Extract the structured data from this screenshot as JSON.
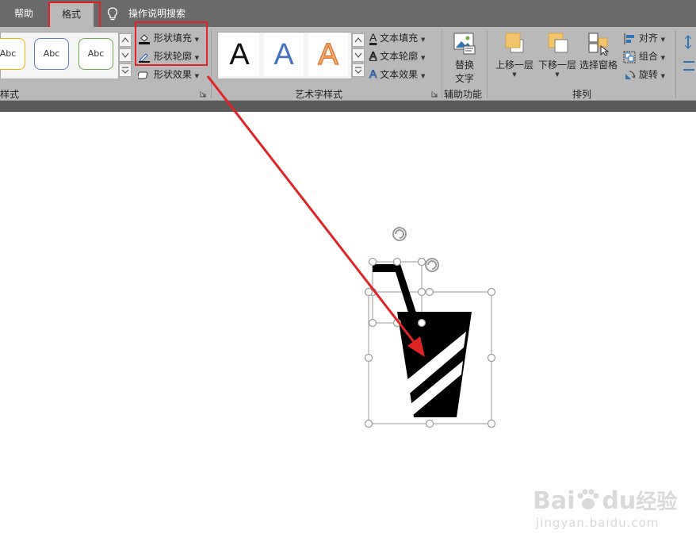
{
  "tabs": {
    "help": "帮助",
    "format": "格式",
    "tell_me": "操作说明搜索"
  },
  "shape_styles": {
    "abc_samples": [
      "Abc",
      "Abc",
      "Abc"
    ],
    "abc_border_colors": [
      "#f0b400",
      "#5b7fbd",
      "#6aa84f"
    ],
    "fill": "形状填充",
    "outline": "形状轮廓",
    "effects": "形状效果",
    "group_label": "样式"
  },
  "wordart": {
    "samples": [
      "A",
      "A",
      "A"
    ],
    "sample_colors": [
      "#111111",
      "#4472c4",
      "#f4b183"
    ],
    "text_fill": "文本填充",
    "text_outline": "文本轮廓",
    "text_effects": "文本效果",
    "group_label": "艺术字样式"
  },
  "accessibility": {
    "alt_text_line1": "替换",
    "alt_text_line2": "文字",
    "group_label": "辅助功能"
  },
  "arrange": {
    "bring_forward": "上移一层",
    "send_backward": "下移一层",
    "selection_pane": "选择窗格",
    "align": "对齐",
    "group": "组合",
    "rotate": "旋转",
    "group_label": "排列"
  },
  "watermark": {
    "brand": "Bai",
    "brand_du": "du",
    "jingyan": "经验",
    "url": "jingyan.baidu.com"
  },
  "colors": {
    "highlight": "#e02424",
    "ribbon": "#b9b9b9",
    "tabbar": "#6a6a6a"
  }
}
